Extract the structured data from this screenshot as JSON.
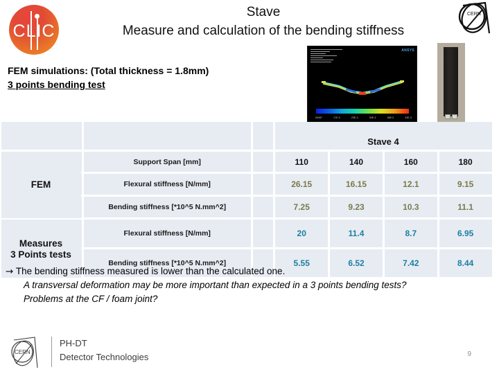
{
  "header": {
    "title_line1": "Stave",
    "title_line2": "Measure and calculation of the bending stiffness",
    "clic_logo_text": "CLIC",
    "cern_logo_text": "CERN"
  },
  "notes": {
    "line1": "FEM simulations: (Total thickness = 1.8mm)",
    "line2": "3 points bending test"
  },
  "figures": {
    "fem_simulation_label": "ANSYS",
    "colorbar_ticks": [
      ".00087",
      ".17E-3",
      ".23E-3",
      ".30E-3",
      ".36E-3",
      ".43E-3"
    ]
  },
  "table": {
    "stave_header": "Stave 4",
    "groups": {
      "fem": "FEM",
      "measures_line1": "Measures",
      "measures_line2": "3 Points tests"
    },
    "metrics": {
      "support_span": "Support Span [mm]",
      "flexural_stiffness": "Flexural stiffness [N/mm]",
      "bending_stiffness": "Bending stiffness [*10^5 N.mm^2]"
    },
    "support_span_values": [
      "110",
      "140",
      "160",
      "180"
    ],
    "fem_flexural_values": [
      "26.15",
      "16.15",
      "12.1",
      "9.15"
    ],
    "fem_bending_values": [
      "7.25",
      "9.23",
      "10.3",
      "11.1"
    ],
    "meas_flexural_values": [
      "20",
      "11.4",
      "8.7",
      "6.95"
    ],
    "meas_bending_values": [
      "5.55",
      "6.52",
      "7.42",
      "8.44"
    ]
  },
  "conclusions": {
    "arrow": "→",
    "line1": "The bending stiffness measured is lower than the calculated one.",
    "line2": "A transversal deformation may be more important than expected in a 3 points bending tests?",
    "line3": "Problems at the CF / foam joint?"
  },
  "footer": {
    "org": "PH-DT",
    "dept": "Detector Technologies",
    "page_number": "9"
  },
  "chart_data": {
    "type": "table",
    "title": "Measure and calculation of the bending stiffness - Stave 4",
    "xlabel": "Support Span [mm]",
    "categories": [
      "110",
      "140",
      "160",
      "180"
    ],
    "series": [
      {
        "name": "FEM Flexural stiffness [N/mm]",
        "values": [
          26.15,
          16.15,
          12.1,
          9.15
        ]
      },
      {
        "name": "FEM Bending stiffness [*10^5 N.mm^2]",
        "values": [
          7.25,
          9.23,
          10.3,
          11.1
        ]
      },
      {
        "name": "Measures 3 Points tests Flexural stiffness [N/mm]",
        "values": [
          20,
          11.4,
          8.7,
          6.95
        ]
      },
      {
        "name": "Measures 3 Points tests Bending stiffness [*10^5 N.mm^2]",
        "values": [
          5.55,
          6.52,
          7.42,
          8.44
        ]
      }
    ]
  }
}
